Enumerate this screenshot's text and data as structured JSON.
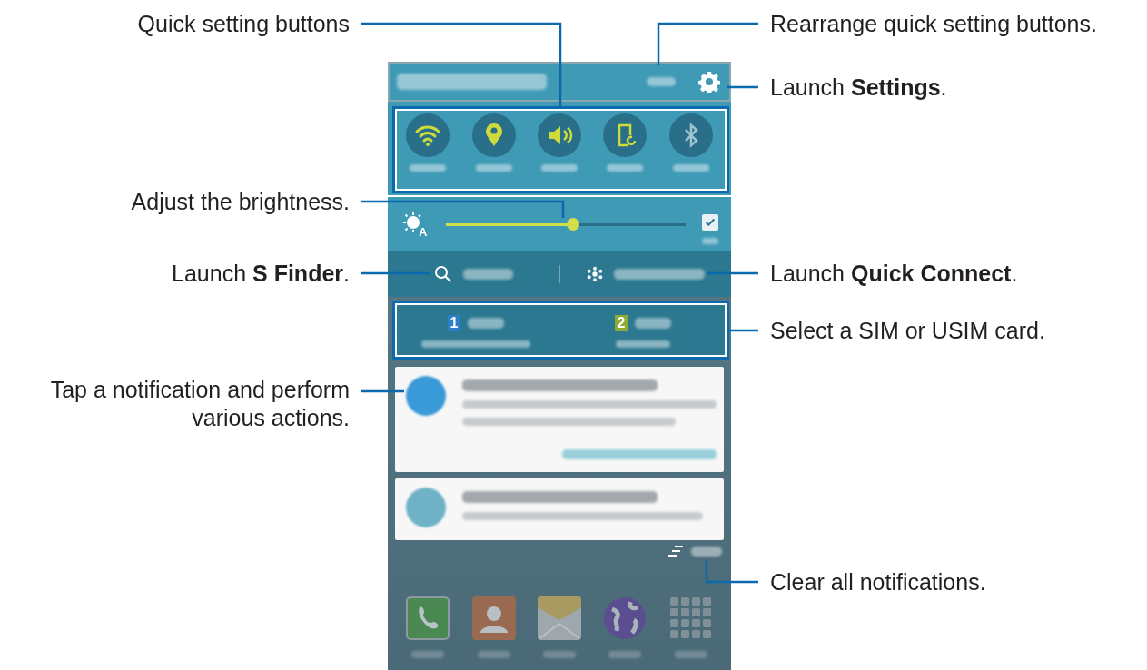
{
  "callouts_left": [
    {
      "text": "Quick setting buttons"
    },
    {
      "text": "Adjust the brightness."
    },
    {
      "text": "Launch **S Finder**."
    },
    {
      "text": "Tap a notification and perform various actions."
    }
  ],
  "callouts_right": [
    {
      "text": "Rearrange quick setting buttons."
    },
    {
      "text": "Launch **Settings**."
    },
    {
      "text": "Launch **Quick Connect**."
    },
    {
      "text": "Select a SIM or USIM card."
    },
    {
      "text": "Clear all notifications."
    }
  ],
  "phone": {
    "quick_settings": [
      {
        "kind": "wifi",
        "on": true
      },
      {
        "kind": "location",
        "on": true
      },
      {
        "kind": "sound",
        "on": true
      },
      {
        "kind": "rotation",
        "on": true
      },
      {
        "kind": "bluetooth",
        "on": false
      }
    ],
    "brightness": {
      "icon_letter": "A",
      "level": 0.53,
      "auto_checked": true
    },
    "sims": [
      {
        "badge": "1",
        "color": "#2a7fc6"
      },
      {
        "badge": "2",
        "color": "#8cab32"
      }
    ],
    "notifications": [
      {
        "kind": "action",
        "color": "#3a9ad8"
      },
      {
        "kind": "plain",
        "color": "#6fb2c8"
      }
    ],
    "dock": [
      {
        "kind": "phone"
      },
      {
        "kind": "contacts"
      },
      {
        "kind": "messages"
      },
      {
        "kind": "internet"
      },
      {
        "kind": "apps"
      }
    ]
  }
}
